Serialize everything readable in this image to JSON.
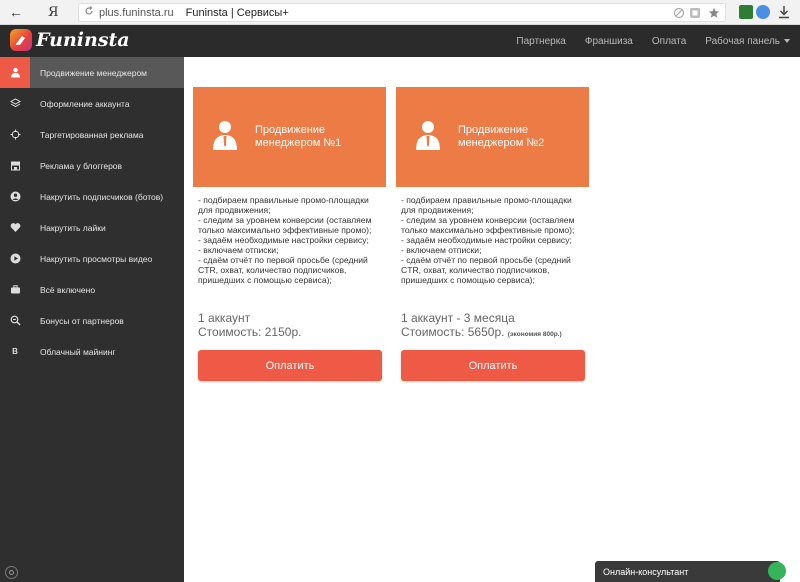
{
  "browser": {
    "back_icon": "←",
    "ya_label": "Я",
    "domain": "plus.funinsta.ru",
    "page_title": "Funinsta | Сервисы+"
  },
  "header": {
    "logo_text": "Funinsta",
    "nav": [
      "Партнерка",
      "Франшиза",
      "Оплата",
      "Рабочая панель"
    ]
  },
  "sidebar": {
    "items": [
      {
        "label": "Продвижение менеджером",
        "icon": "person-icon"
      },
      {
        "label": "Оформление аккаунта",
        "icon": "layers-icon"
      },
      {
        "label": "Таргетированная реклама",
        "icon": "target-icon"
      },
      {
        "label": "Реклама у блоггеров",
        "icon": "store-icon"
      },
      {
        "label": "Накрутить подписчиков (ботов)",
        "icon": "user-circle-icon"
      },
      {
        "label": "Накрутить лайки",
        "icon": "heart-icon"
      },
      {
        "label": "Накрутить просмотры видео",
        "icon": "play-icon"
      },
      {
        "label": "Всё включено",
        "icon": "briefcase-icon"
      },
      {
        "label": "Бонусы от партнеров",
        "icon": "zoom-icon"
      },
      {
        "label": "Облачный майнинг",
        "icon": "bitcoin-icon"
      }
    ],
    "bitcoin_glyph": "B"
  },
  "cards": [
    {
      "title": "Продвижение менеджером №1",
      "desc": [
        "- подбираем правильные промо-площадки для продвижения;",
        "- следим за уровнем конверсии (оставляем только максимально эффективные промо);",
        "- задаём необходимые настройки сервису;",
        "- включаем отписки;",
        "- сдаём отчёт по первой просьбе (средний CTR, охват, количество подписчиков, пришедших с помощью сервиса);"
      ],
      "price_line1": "1 аккаунт",
      "price_line2": "Стоимость: 2150р.",
      "price_note": "",
      "button": "Оплатить"
    },
    {
      "title": "Продвижение менеджером №2",
      "desc": [
        "- подбираем правильные промо-площадки для продвижения;",
        "- следим за уровнем конверсии (оставляем только максимально эффективные промо);",
        "- задаём необходимые настройки сервису;",
        "- включаем отписки;",
        "- сдаём отчёт по первой просьбе (средний CTR, охват, количество подписчиков, пришедших с помощью сервиса);"
      ],
      "price_line1": "1 аккаунт - 3 месяца",
      "price_line2": "Стоимость: 5650р.",
      "price_note": "(экономия 800р.)",
      "button": "Оплатить"
    }
  ],
  "consultant": {
    "label": "Онлайн-консультант"
  },
  "colors": {
    "accent": "#ee5a45",
    "card_header": "#ed7b45",
    "sidebar_bg": "#2f2f2f",
    "header_bg": "#2b2b2b"
  }
}
